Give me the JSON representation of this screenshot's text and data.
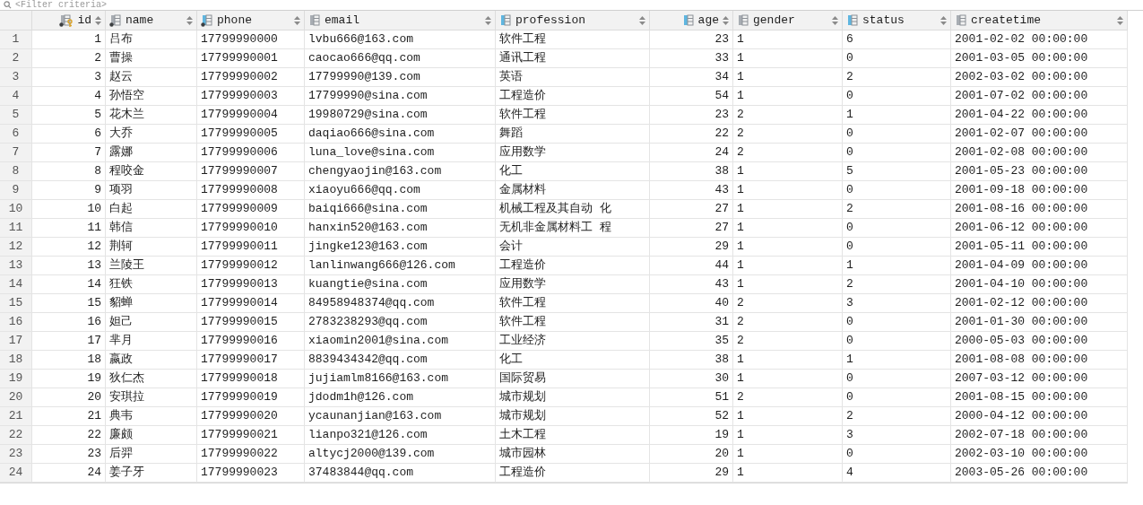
{
  "filter": {
    "placeholder": "<Filter criteria>"
  },
  "columns": [
    {
      "name": "id",
      "kind": "number",
      "primary_key": true,
      "indexed": false,
      "not_null": true
    },
    {
      "name": "name",
      "kind": "text",
      "primary_key": false,
      "indexed": false,
      "not_null": true
    },
    {
      "name": "phone",
      "kind": "text",
      "primary_key": false,
      "indexed": true,
      "not_null": true
    },
    {
      "name": "email",
      "kind": "text",
      "primary_key": false,
      "indexed": false,
      "not_null": false
    },
    {
      "name": "profession",
      "kind": "text",
      "primary_key": false,
      "indexed": true,
      "not_null": false
    },
    {
      "name": "age",
      "kind": "number",
      "primary_key": false,
      "indexed": true,
      "not_null": false
    },
    {
      "name": "gender",
      "kind": "text",
      "primary_key": false,
      "indexed": false,
      "not_null": false
    },
    {
      "name": "status",
      "kind": "text",
      "primary_key": false,
      "indexed": true,
      "not_null": false
    },
    {
      "name": "createtime",
      "kind": "text",
      "primary_key": false,
      "indexed": false,
      "not_null": false
    }
  ],
  "rows": [
    {
      "n": "1",
      "cells": [
        "1",
        "吕布",
        "17799990000",
        "lvbu666@163.com",
        "软件工程",
        "23",
        "1",
        "6",
        "2001-02-02 00:00:00"
      ]
    },
    {
      "n": "2",
      "cells": [
        "2",
        "曹操",
        "17799990001",
        "caocao666@qq.com",
        "通讯工程",
        "33",
        "1",
        "0",
        "2001-03-05 00:00:00"
      ]
    },
    {
      "n": "3",
      "cells": [
        "3",
        "赵云",
        "17799990002",
        "17799990@139.com",
        "英语",
        "34",
        "1",
        "2",
        "2002-03-02 00:00:00"
      ]
    },
    {
      "n": "4",
      "cells": [
        "4",
        "孙悟空",
        "17799990003",
        "17799990@sina.com",
        "工程造价",
        "54",
        "1",
        "0",
        "2001-07-02 00:00:00"
      ]
    },
    {
      "n": "5",
      "cells": [
        "5",
        "花木兰",
        "17799990004",
        "19980729@sina.com",
        "软件工程",
        "23",
        "2",
        "1",
        "2001-04-22 00:00:00"
      ]
    },
    {
      "n": "6",
      "cells": [
        "6",
        "大乔",
        "17799990005",
        "daqiao666@sina.com",
        "舞蹈",
        "22",
        "2",
        "0",
        "2001-02-07 00:00:00"
      ]
    },
    {
      "n": "7",
      "cells": [
        "7",
        "露娜",
        "17799990006",
        "luna_love@sina.com",
        "应用数学",
        "24",
        "2",
        "0",
        "2001-02-08 00:00:00"
      ]
    },
    {
      "n": "8",
      "cells": [
        "8",
        "程咬金",
        "17799990007",
        "chengyaojin@163.com",
        "化工",
        "38",
        "1",
        "5",
        "2001-05-23 00:00:00"
      ]
    },
    {
      "n": "9",
      "cells": [
        "9",
        "项羽",
        "17799990008",
        "xiaoyu666@qq.com",
        "金属材料",
        "43",
        "1",
        "0",
        "2001-09-18 00:00:00"
      ]
    },
    {
      "n": "10",
      "cells": [
        "10",
        "白起",
        "17799990009",
        "baiqi666@sina.com",
        "机械工程及其自动 化",
        "27",
        "1",
        "2",
        "2001-08-16 00:00:00"
      ]
    },
    {
      "n": "11",
      "cells": [
        "11",
        "韩信",
        "17799990010",
        "hanxin520@163.com",
        "无机非金属材料工 程",
        "27",
        "1",
        "0",
        "2001-06-12 00:00:00"
      ]
    },
    {
      "n": "12",
      "cells": [
        "12",
        "荆轲",
        "17799990011",
        "jingke123@163.com",
        "会计",
        "29",
        "1",
        "0",
        "2001-05-11 00:00:00"
      ]
    },
    {
      "n": "13",
      "cells": [
        "13",
        "兰陵王",
        "17799990012",
        "lanlinwang666@126.com",
        "工程造价",
        "44",
        "1",
        "1",
        "2001-04-09 00:00:00"
      ]
    },
    {
      "n": "14",
      "cells": [
        "14",
        "狂铁",
        "17799990013",
        "kuangtie@sina.com",
        "应用数学",
        "43",
        "1",
        "2",
        "2001-04-10 00:00:00"
      ]
    },
    {
      "n": "15",
      "cells": [
        "15",
        "貂蝉",
        "17799990014",
        "84958948374@qq.com",
        "软件工程",
        "40",
        "2",
        "3",
        "2001-02-12 00:00:00"
      ]
    },
    {
      "n": "16",
      "cells": [
        "16",
        "妲己",
        "17799990015",
        "2783238293@qq.com",
        "软件工程",
        "31",
        "2",
        "0",
        "2001-01-30 00:00:00"
      ]
    },
    {
      "n": "17",
      "cells": [
        "17",
        "芈月",
        "17799990016",
        "xiaomin2001@sina.com",
        "工业经济",
        "35",
        "2",
        "0",
        "2000-05-03 00:00:00"
      ]
    },
    {
      "n": "18",
      "cells": [
        "18",
        "嬴政",
        "17799990017",
        "8839434342@qq.com",
        "化工",
        "38",
        "1",
        "1",
        "2001-08-08 00:00:00"
      ]
    },
    {
      "n": "19",
      "cells": [
        "19",
        "狄仁杰",
        "17799990018",
        "jujiamlm8166@163.com",
        "国际贸易",
        "30",
        "1",
        "0",
        "2007-03-12 00:00:00"
      ]
    },
    {
      "n": "20",
      "cells": [
        "20",
        "安琪拉",
        "17799990019",
        "jdodm1h@126.com",
        "城市规划",
        "51",
        "2",
        "0",
        "2001-08-15 00:00:00"
      ]
    },
    {
      "n": "21",
      "cells": [
        "21",
        "典韦",
        "17799990020",
        "ycaunanjian@163.com",
        "城市规划",
        "52",
        "1",
        "2",
        "2000-04-12 00:00:00"
      ]
    },
    {
      "n": "22",
      "cells": [
        "22",
        "廉颇",
        "17799990021",
        "lianpo321@126.com",
        "土木工程",
        "19",
        "1",
        "3",
        "2002-07-18 00:00:00"
      ]
    },
    {
      "n": "23",
      "cells": [
        "23",
        "后羿",
        "17799990022",
        "altycj2000@139.com",
        "城市园林",
        "20",
        "1",
        "0",
        "2002-03-10 00:00:00"
      ]
    },
    {
      "n": "24",
      "cells": [
        "24",
        "姜子牙",
        "17799990023",
        "37483844@qq.com",
        "工程造价",
        "29",
        "1",
        "4",
        "2003-05-26 00:00:00"
      ]
    }
  ]
}
